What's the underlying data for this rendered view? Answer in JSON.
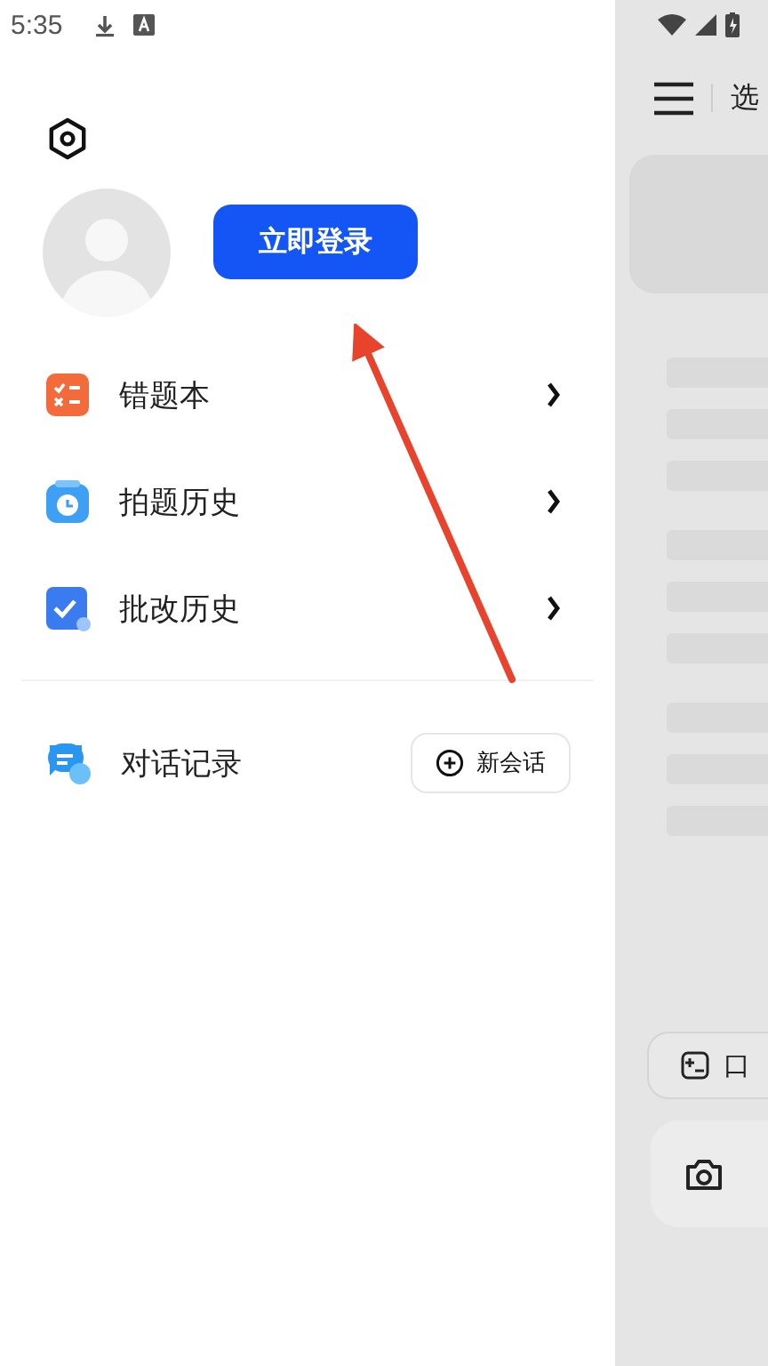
{
  "status_bar": {
    "time": "5:35"
  },
  "drawer": {
    "login_button": "立即登录",
    "menu_items": [
      {
        "kind": "wrongbook",
        "label": "错题本"
      },
      {
        "kind": "photo",
        "label": "拍题历史"
      },
      {
        "kind": "review",
        "label": "批改历史"
      }
    ],
    "chat_history": {
      "label": "对话记录",
      "new_chat_button": "新会话"
    }
  },
  "background_page": {
    "title": "选",
    "quick_button": "口"
  }
}
